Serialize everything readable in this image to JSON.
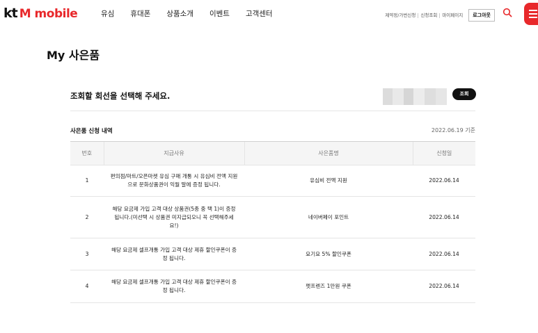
{
  "brand": {
    "kt": "kt",
    "mobile": "M mobile",
    "accent": "#e8282b"
  },
  "nav": [
    "유심",
    "휴대폰",
    "상품소개",
    "이벤트",
    "고객센터"
  ],
  "util_links": [
    "제약정/가번신청",
    "신청조회",
    "마이페이지"
  ],
  "logout_label": "로그아웃",
  "icons": {
    "search": "search-icon",
    "menu": "hamburger-menu-icon"
  },
  "page_title": "My 사은품",
  "line_select": {
    "label": "조회할 회선을 선택해 주세요.",
    "query_label": "조회"
  },
  "history": {
    "title": "사은품 신청 내역",
    "date_note": "2022.06.19 기준",
    "columns": [
      "번호",
      "지급사유",
      "사은품명",
      "신청일"
    ],
    "rows": [
      {
        "no": "1",
        "reason": "편의점/마트/오픈마켓 유심 구매 개통 시 유심비 전액 지원으로 문화상품권이 익월 말에 증정 됩니다.",
        "item": "유심비 전액 지원",
        "date": "2022.06.14"
      },
      {
        "no": "2",
        "reason": "해당 요금제 가입 고객 대상 상품권(5종 중 택 1)이 증정 됩니다.(미선택 시 상품권 미지급되오니 꼭 선택해주세요!)",
        "item": "네이버페이 포인트",
        "date": "2022.06.14"
      },
      {
        "no": "3",
        "reason": "해당 요금제 셀프개통 가입 고객 대상 제휴 할인쿠폰이 증정 됩니다.",
        "item": "요기요 5% 할인쿠폰",
        "date": "2022.06.14"
      },
      {
        "no": "4",
        "reason": "해당 요금제 셀프개통 가입 고객 대상 제휴 할인쿠폰이 증정 됩니다.",
        "item": "펫프렌즈 1만원 쿠폰",
        "date": "2022.06.14"
      }
    ]
  }
}
